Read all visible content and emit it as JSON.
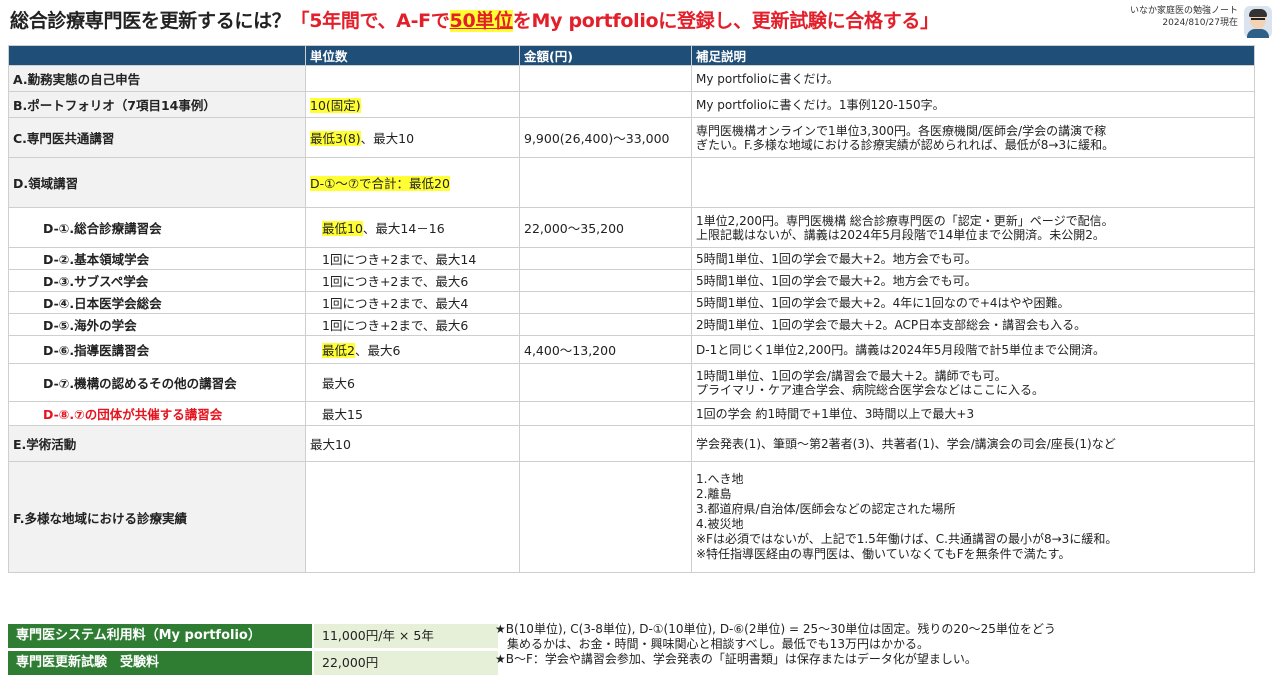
{
  "header": {
    "title_a": "総合診療専門医を更新するには？",
    "title_b": "「5年間で、A-Fで",
    "title_hl": "50単位",
    "title_c": "をMy portfolioに登録し、更新試験に合格する」",
    "note_line1": "いなか家庭医の勉強ノート",
    "note_line2": "2024/810/27現在"
  },
  "columns": [
    "",
    "単位数",
    "金額(円)",
    "補足説明"
  ],
  "sections": {
    "A": {
      "label": "A.勤務実態の自己申告",
      "units": "",
      "cost": "",
      "desc": [
        "My portfolioに書くだけ。"
      ]
    },
    "B": {
      "label": "B.ポートフォリオ（7項目14事例）",
      "units_hl": "10(固定)",
      "cost": "",
      "desc": [
        "My portfolioに書くだけ。1事例120-150字。"
      ]
    },
    "C": {
      "label": "C.専門医共通講習",
      "units_hl": "最低3(8)",
      "units_rest": "、最大10",
      "cost": "9,900(26,400)～33,000",
      "desc": [
        "専門医機構オンラインで1単位3,300円。各医療機関/医師会/学会の講演で稼",
        "ぎたい。F.多様な地域における診療実績が認められれば、最低が8→3に緩和。"
      ]
    },
    "D": {
      "label": "D.領域講習",
      "units_hl": "D-①～⑦で合計：最低20",
      "cost": "",
      "desc": []
    },
    "D1": {
      "label": "D-①.総合診療講習会",
      "units_hl": "最低10",
      "units_rest": "、最大14－16",
      "cost": "22,000～35,200",
      "desc": [
        "1単位2,200円。専門医機構 総合診療専門医の「認定・更新」ページで配信。",
        "上限記載はないが、講義は2024年5月段階で14単位まで公開済。未公開2。"
      ]
    },
    "D2": {
      "label": "D-②.基本領域学会",
      "units": "1回につき+2まで、最大14",
      "cost": "",
      "desc": [
        "5時間1単位、1回の学会で最大+2。地方会でも可。"
      ]
    },
    "D3": {
      "label": "D-③.サブスペ学会",
      "units": "1回につき+2まで、最大6",
      "cost": "",
      "desc": [
        "5時間1単位、1回の学会で最大+2。地方会でも可。"
      ]
    },
    "D4": {
      "label": "D-④.日本医学会総会",
      "units": "1回につき+2まで、最大4",
      "cost": "",
      "desc": [
        "5時間1単位、1回の学会で最大+2。4年に1回なので+4はやや困難。"
      ]
    },
    "D5": {
      "label": "D-⑤.海外の学会",
      "units": "1回につき+2まで、最大6",
      "cost": "",
      "desc": [
        "2時間1単位、1回の学会で最大＋2。ACP日本支部総会・講習会も入る。"
      ]
    },
    "D6": {
      "label": "D-⑥.指導医講習会",
      "units_hl": "最低2",
      "units_rest": "、最大6",
      "cost": "4,400～13,200",
      "desc": [
        "D-1と同じく1単位2,200円。講義は2024年5月段階で計5単位まで公開済。"
      ]
    },
    "D7": {
      "label": "D-⑦.機構の認めるその他の講習会",
      "units": "最大6",
      "cost": "",
      "desc": [
        "1時間1単位、1回の学会/講習会で最大＋2。講師でも可。",
        "プライマリ・ケア連合学会、病院総合医学会などはここに入る。"
      ]
    },
    "D8": {
      "label": "D-⑧.⑦の団体が共催する講習会",
      "units": "最大15",
      "cost": "",
      "desc": [
        "1回の学会 約1時間で+1単位、3時間以上で最大+3"
      ]
    },
    "E": {
      "label": "E.学術活動",
      "units": "最大10",
      "cost": "",
      "desc": [
        "学会発表(1)、筆頭～第2著者(3)、共著者(1)、学会/講演会の司会/座長(1)など"
      ]
    },
    "F": {
      "label": "F.多様な地域における診療実績",
      "units": "",
      "cost": "",
      "desc": [
        "1.へき地",
        "2.離島",
        "3.都道府県/自治体/医師会などの認定された場所",
        "4.被災地",
        "※Fは必須ではないが、上記で1.5年働けば、C.共通講習の最小が8→3に緩和。",
        "※特任指導医経由の専門医は、働いていなくてもFを無条件で満たす。"
      ]
    }
  },
  "fees": [
    {
      "label": "専門医システム利用料（My portfolio）",
      "value": "11,000円/年 × 5年"
    },
    {
      "label": "専門医更新試験　受験料",
      "value": "22,000円"
    }
  ],
  "footnotes": [
    "★B(10単位), C(3-8単位), D-①(10単位), D-⑥(2単位) = 25～30単位は固定。残りの20～25単位をどう",
    "　集めるかは、お金・時間・興味関心と相談すべし。最低でも13万円はかかる。",
    "★B～F：学会や講習会参加、学会発表の「証明書類」は保存またはデータ化が望ましい。"
  ],
  "colors": {
    "header_bg": "#1f4e79",
    "highlight": "#ffff33",
    "accent_red": "#e21f2a",
    "fee_label_bg": "#2e7d32",
    "fee_value_bg": "#e6f0d8"
  }
}
